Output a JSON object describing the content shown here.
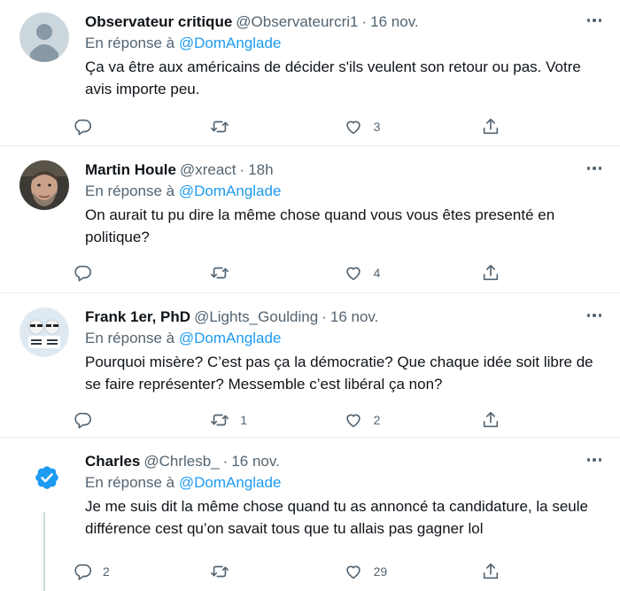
{
  "reply_prefix": "En réponse à",
  "tweets": [
    {
      "name": "Observateur critique",
      "handle": "@Observateurcri1",
      "time": "16 nov.",
      "reply_to": "@DomAnglade",
      "text": "Ça va être aux américains de décider s'ils veulent son retour ou pas. Votre avis importe peu.",
      "replies": "",
      "retweets": "",
      "likes": "3",
      "avatar": "default-avatar"
    },
    {
      "name": "Martin Houle",
      "handle": "@xreact",
      "time": "18h",
      "reply_to": "@DomAnglade",
      "text": "On aurait tu pu dire la même chose quand vous vous êtes presenté en politique?",
      "replies": "",
      "retweets": "",
      "likes": "4",
      "avatar": "photo-avatar"
    },
    {
      "name": "Frank 1er, PhD",
      "handle": "@Lights_Goulding",
      "time": "16 nov.",
      "reply_to": "@DomAnglade",
      "text": "Pourquoi misère? C’est pas ça la démocratie? Que chaque idée soit libre de se faire représenter? Messemble c’est libéral ça non?",
      "replies": "",
      "retweets": "1",
      "likes": "2",
      "avatar": "cartoon-avatar"
    },
    {
      "name": "Charles",
      "handle": "@Chrlesb_",
      "time": "16 nov.",
      "reply_to": "@DomAnglade",
      "text": "Je me suis dit la même chose quand tu as annoncé ta candidature, la seule différence cest qu’on savait tous que tu allais pas gagner lol",
      "replies": "2",
      "retweets": "",
      "likes": "29",
      "avatar": "verified-badge"
    }
  ],
  "colors": {
    "link": "#1d9bf0",
    "secondary": "#536471",
    "text": "#0f1419",
    "divider": "#e6ecf0"
  }
}
